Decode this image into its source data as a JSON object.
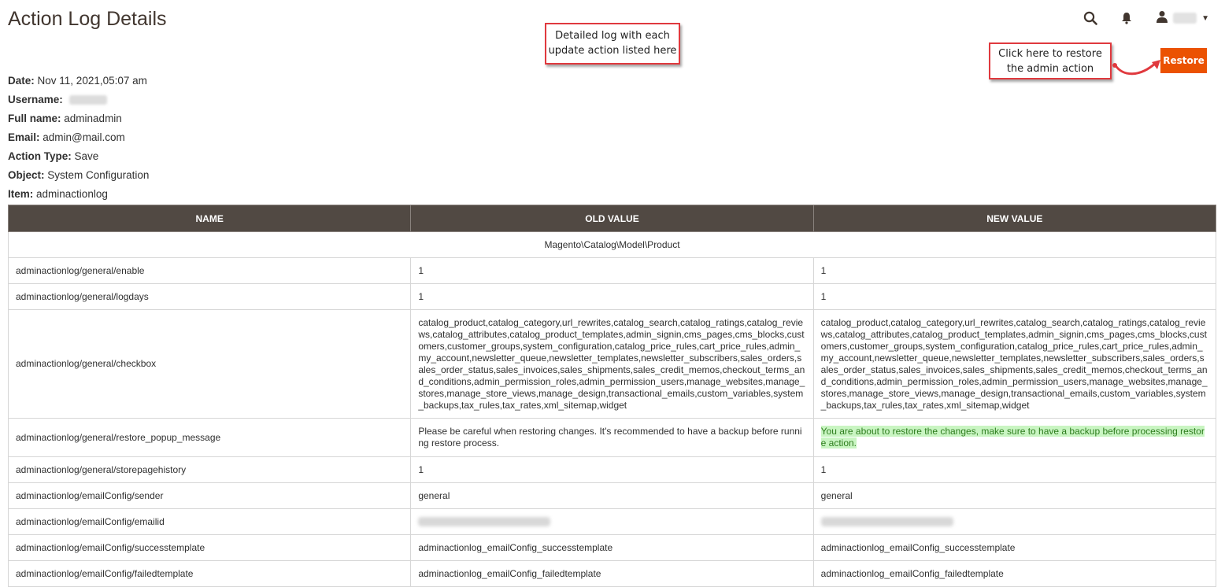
{
  "page": {
    "title": "Action Log Details"
  },
  "header": {
    "search_icon": "search-icon",
    "notifications_icon": "bell-icon",
    "user_icon": "user-icon"
  },
  "annotations": {
    "log_callout_line1": "Detailed log with each",
    "log_callout_line2": "update action listed here",
    "restore_callout_line1": "Click here to restore",
    "restore_callout_line2": "the admin action"
  },
  "actions": {
    "restore_label": "Restore"
  },
  "details": {
    "date_label": "Date:",
    "date_value": "Nov 11, 2021,05:07 am",
    "username_label": "Username:",
    "fullname_label": "Full name:",
    "fullname_value": "adminadmin",
    "email_label": "Email:",
    "email_value": "admin@mail.com",
    "action_type_label": "Action Type:",
    "action_type_value": "Save",
    "object_label": "Object:",
    "object_value": "System Configuration",
    "item_label": "Item:",
    "item_value": "adminactionlog"
  },
  "table": {
    "columns": [
      "NAME",
      "OLD VALUE",
      "NEW VALUE"
    ],
    "group": "Magento\\Catalog\\Model\\Product",
    "rows": [
      {
        "name": "adminactionlog/general/enable",
        "old": "1",
        "new": "1"
      },
      {
        "name": "adminactionlog/general/logdays",
        "old": "1",
        "new": "1"
      },
      {
        "name": "adminactionlog/general/checkbox",
        "old": "catalog_product,catalog_category,url_rewrites,catalog_search,catalog_ratings,catalog_reviews,catalog_attributes,catalog_product_templates,admin_signin,cms_pages,cms_blocks,customers,customer_groups,system_configuration,catalog_price_rules,cart_price_rules,admin_my_account,newsletter_queue,newsletter_templates,newsletter_subscribers,sales_orders,sales_order_status,sales_invoices,sales_shipments,sales_credit_memos,checkout_terms_and_conditions,admin_permission_roles,admin_permission_users,manage_websites,manage_stores,manage_store_views,manage_design,transactional_emails,custom_variables,system_backups,tax_rules,tax_rates,xml_sitemap,widget",
        "new": "catalog_product,catalog_category,url_rewrites,catalog_search,catalog_ratings,catalog_reviews,catalog_attributes,catalog_product_templates,admin_signin,cms_pages,cms_blocks,customers,customer_groups,system_configuration,catalog_price_rules,cart_price_rules,admin_my_account,newsletter_queue,newsletter_templates,newsletter_subscribers,sales_orders,sales_order_status,sales_invoices,sales_shipments,sales_credit_memos,checkout_terms_and_conditions,admin_permission_roles,admin_permission_users,manage_websites,manage_stores,manage_store_views,manage_design,transactional_emails,custom_variables,system_backups,tax_rules,tax_rates,xml_sitemap,widget"
      },
      {
        "name": "adminactionlog/general/restore_popup_message",
        "old": "Please be careful when restoring changes. It's recommended to have a backup before running restore process.",
        "new": "You are about to restore the changes, make sure to have a backup before processing restore action."
      },
      {
        "name": "adminactionlog/general/storepagehistory",
        "old": "1",
        "new": "1"
      },
      {
        "name": "adminactionlog/emailConfig/sender",
        "old": "general",
        "new": "general"
      },
      {
        "name": "adminactionlog/emailConfig/emailid",
        "old": "",
        "new": ""
      },
      {
        "name": "adminactionlog/emailConfig/successtemplate",
        "old": "adminactionlog_emailConfig_successtemplate",
        "new": "adminactionlog_emailConfig_successtemplate"
      },
      {
        "name": "adminactionlog/emailConfig/failedtemplate",
        "old": "adminactionlog_emailConfig_failedtemplate",
        "new": "adminactionlog_emailConfig_failedtemplate"
      }
    ]
  },
  "colors": {
    "header_bg": "#514943",
    "restore_button": "#eb5202",
    "callout_border": "#e0393e",
    "highlight_bg": "#c9f5c2",
    "highlight_text": "#2e7d1e"
  }
}
